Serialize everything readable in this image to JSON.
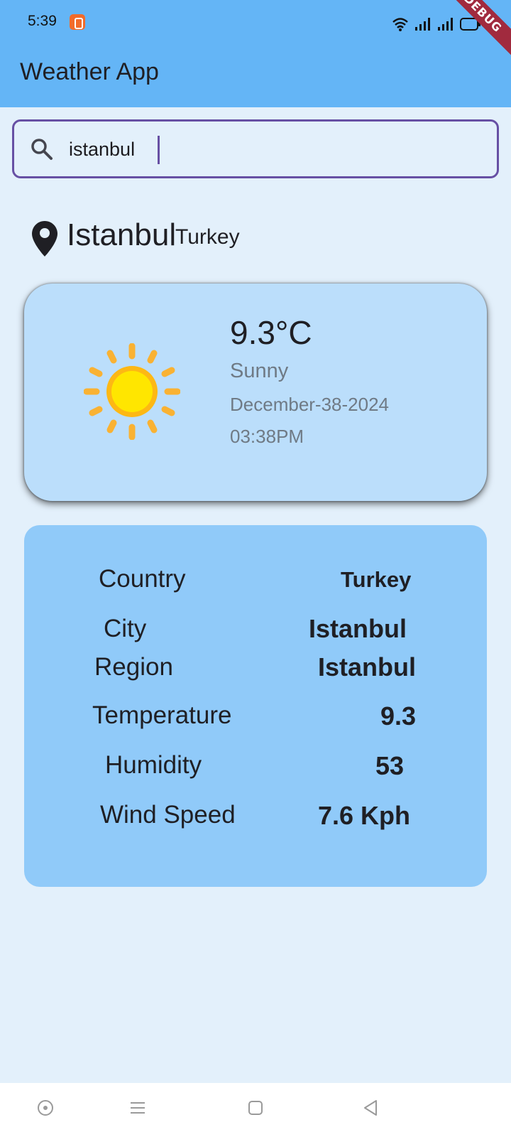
{
  "status_bar": {
    "time": "5:39",
    "debug_label": "DEBUG"
  },
  "app_bar": {
    "title": "Weather App"
  },
  "search": {
    "value": "istanbul"
  },
  "location": {
    "city": "Istanbul",
    "country": "Turkey"
  },
  "current": {
    "temperature": "9.3°C",
    "condition": "Sunny",
    "date": "December-38-2024",
    "time": "03:38PM",
    "icon": "sun-icon"
  },
  "details": {
    "country_label": "Country",
    "country_value": "Turkey",
    "city_label": "City",
    "city_value": "Istanbul",
    "region_label": "Region",
    "region_value": "Istanbul",
    "temperature_label": "Temperature",
    "temperature_value": "9.3",
    "humidity_label": "Humidity",
    "humidity_value": "53",
    "wind_label": "Wind Speed",
    "wind_value": "7.6 Kph"
  },
  "colors": {
    "app_bar": "#64b5f6",
    "background": "#e3f0fb",
    "weather_card": "#bbdefb",
    "details_card": "#90caf9",
    "search_border": "#6750a4"
  }
}
